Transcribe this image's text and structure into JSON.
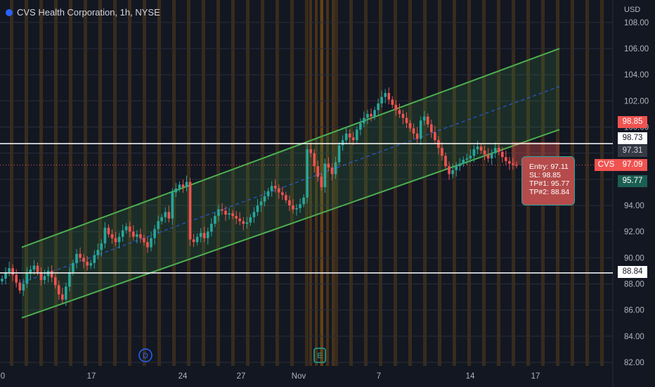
{
  "header": {
    "title": "CVS Health Corporation, 1h, NYSE",
    "currency": "USD"
  },
  "colors": {
    "background": "#131722",
    "up": "#26a69a",
    "down": "#f05350",
    "channel": "#4caf50",
    "midline": "#2962ff",
    "session_highlight": "#ff9800"
  },
  "price_labels": {
    "sl": "98.85",
    "level_high": "98.73",
    "last_grey": "97.31",
    "current": "97.09",
    "tp1": "95.77",
    "tp2": "88.84"
  },
  "ticker": "CVS",
  "trade_tooltip": {
    "entry": "Entry: 97.11",
    "sl": "SL: 98.85",
    "tp1": "TP#1: 95.77",
    "tp2": "TP#2: 88.84"
  },
  "event_markers": [
    {
      "letter": "D",
      "color": "#2962ff"
    },
    {
      "letter": "E",
      "color": "#26a69a"
    }
  ],
  "chart_data": {
    "type": "candlestick",
    "title": "CVS Health Corporation, 1h, NYSE",
    "y_axis": {
      "ticks": [
        "82.00",
        "84.00",
        "86.00",
        "88.00",
        "90.00",
        "92.00",
        "94.00",
        "96.00",
        "98.00",
        "100.00",
        "102.00",
        "104.00",
        "106.00",
        "108.00"
      ],
      "range": [
        82,
        108.5
      ]
    },
    "x_axis": {
      "ticks": [
        "0",
        "17",
        "24",
        "27",
        "Nov",
        "7",
        "14",
        "17"
      ]
    },
    "horizontal_lines": [
      98.73,
      88.84
    ],
    "current_price": 97.09,
    "channel": {
      "upper": [
        [
          0.0,
          90.8
        ],
        [
          1.0,
          106.0
        ]
      ],
      "lower": [
        [
          0.0,
          85.4
        ],
        [
          1.0,
          99.8
        ]
      ],
      "mid_dashed": [
        [
          0.0,
          88.1
        ],
        [
          1.0,
          103.1
        ]
      ]
    },
    "sl_zone": {
      "from": 97.09,
      "to": 98.85
    },
    "series": [
      {
        "name": "CVS",
        "closes": [
          88.4,
          88.9,
          89.2,
          88.7,
          88.1,
          87.5,
          88.0,
          88.8,
          89.1,
          89.4,
          88.9,
          88.3,
          88.6,
          89.0,
          88.5,
          87.9,
          87.2,
          86.8,
          87.8,
          88.9,
          89.6,
          90.3,
          90.0,
          89.7,
          89.4,
          89.6,
          90.2,
          90.6,
          91.1,
          92.3,
          91.8,
          91.5,
          91.2,
          91.6,
          92.1,
          92.4,
          92.0,
          91.6,
          91.8,
          91.5,
          91.2,
          90.8,
          91.5,
          92.2,
          92.8,
          93.1,
          93.5,
          93.0,
          95.0,
          95.3,
          95.6,
          95.4,
          95.8,
          91.4,
          91.2,
          91.6,
          91.9,
          91.5,
          92.0,
          92.6,
          93.2,
          93.7,
          93.6,
          93.3,
          93.4,
          93.2,
          93.0,
          92.8,
          92.6,
          92.7,
          93.1,
          93.5,
          94.0,
          94.3,
          94.7,
          95.1,
          95.5,
          95.3,
          95.0,
          94.8,
          94.4,
          94.0,
          93.7,
          93.8,
          94.1,
          94.6,
          98.3,
          98.0,
          97.0,
          96.2,
          95.4,
          97.2,
          96.9,
          96.4,
          97.3,
          98.6,
          99.0,
          99.5,
          99.2,
          99.0,
          99.8,
          100.3,
          100.7,
          101.0,
          100.8,
          101.3,
          101.8,
          102.3,
          102.6,
          102.1,
          101.7,
          101.3,
          101.0,
          100.7,
          100.3,
          99.9,
          99.5,
          99.1,
          100.5,
          100.8,
          100.2,
          99.6,
          99.0,
          98.4,
          97.8,
          97.0,
          96.4,
          96.7,
          97.0,
          97.2,
          97.5,
          97.6,
          97.8,
          98.3,
          98.5,
          98.2,
          97.9,
          97.6,
          98.0,
          98.4,
          98.1,
          97.7,
          97.4,
          97.2,
          97.1,
          97.09
        ]
      }
    ]
  }
}
